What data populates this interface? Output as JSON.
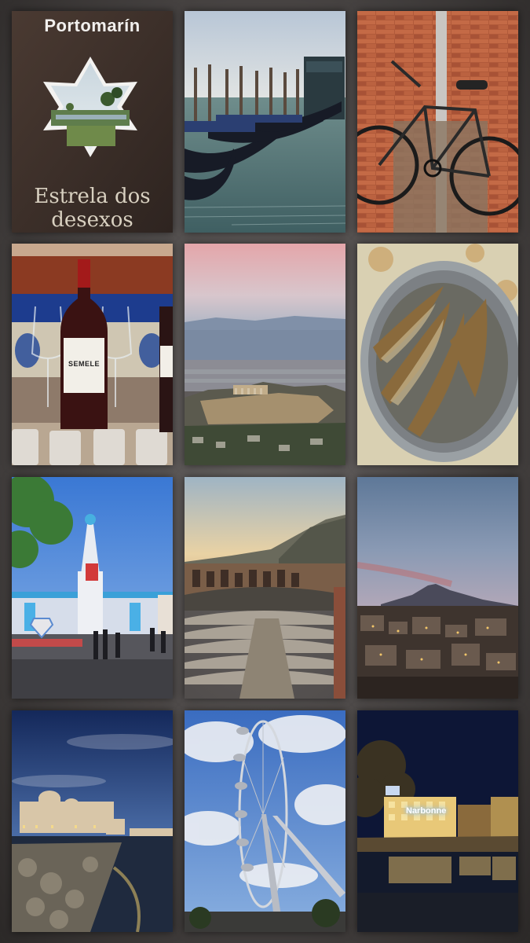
{
  "collage": {
    "tiles": [
      {
        "id": "portomarin-sign",
        "sign_title": "Portomarín",
        "sign_subtitle_line1": "Estrela dos",
        "sign_subtitle_line2": "desexos"
      },
      {
        "id": "venice-gondolas"
      },
      {
        "id": "bicycle-brick-wall"
      },
      {
        "id": "wine-bottles",
        "bottle_label": "SEMELE"
      },
      {
        "id": "athens-acropolis-dusk"
      },
      {
        "id": "grilled-sardines"
      },
      {
        "id": "superman-theme-park"
      },
      {
        "id": "greek-theatre-taormina"
      },
      {
        "id": "etna-town-dusk"
      },
      {
        "id": "seafront-cathedral-night"
      },
      {
        "id": "london-eye"
      },
      {
        "id": "narbonne-canal-night",
        "neon_sign": "Narbonne"
      }
    ]
  },
  "colors": {
    "background": "#4a4645",
    "sky_blue": "#4f8fd8",
    "dusk_pink": "#e9b4b8",
    "night_navy": "#0d1636"
  }
}
